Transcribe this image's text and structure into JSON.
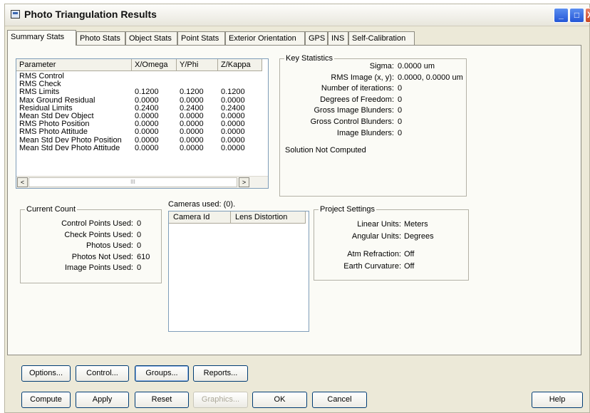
{
  "window": {
    "title": "Photo Triangulation Results",
    "controls": {
      "minimize": "_",
      "maximize": "□",
      "close": "X"
    }
  },
  "tabs": [
    {
      "label": "Summary Stats",
      "accel": "S",
      "active": true
    },
    {
      "label": "Photo Stats",
      "accel": "t",
      "active": false
    },
    {
      "label": "Object Stats",
      "accel": "b",
      "active": false
    },
    {
      "label": "Point Stats",
      "accel": "i",
      "active": false
    },
    {
      "label": "Exterior Orientation",
      "accel": "x",
      "active": false
    },
    {
      "label": "GPS",
      "accel": "",
      "active": false
    },
    {
      "label": "INS",
      "accel": "",
      "active": false
    },
    {
      "label": "Self-Calibration",
      "accel": "",
      "active": false
    }
  ],
  "summary_table": {
    "columns": [
      "Parameter",
      "X/Omega",
      "Y/Phi",
      "Z/Kappa"
    ],
    "rows": [
      [
        "RMS Control",
        "",
        "",
        ""
      ],
      [
        "RMS Check",
        "",
        "",
        ""
      ],
      [
        "RMS Limits",
        "0.1200",
        "0.1200",
        "0.1200"
      ],
      [
        "Max Ground Residual",
        "0.0000",
        "0.0000",
        "0.0000"
      ],
      [
        "Residual Limits",
        "0.2400",
        "0.2400",
        "0.2400"
      ],
      [
        "Mean Std Dev Object",
        "0.0000",
        "0.0000",
        "0.0000"
      ],
      [
        "RMS Photo Position",
        "0.0000",
        "0.0000",
        "0.0000"
      ],
      [
        "RMS Photo Attitude",
        "0.0000",
        "0.0000",
        "0.0000"
      ],
      [
        "Mean Std Dev Photo Position",
        "0.0000",
        "0.0000",
        "0.0000"
      ],
      [
        "Mean Std Dev Photo Attitude",
        "0.0000",
        "0.0000",
        "0.0000"
      ]
    ],
    "scroll_left": "<",
    "scroll_right": ">",
    "thumb_grip": "III"
  },
  "key_statistics": {
    "legend": "Key Statistics",
    "items": [
      {
        "label": "Sigma:",
        "value": "0.0000  um"
      },
      {
        "label": "RMS Image (x, y):",
        "value": "0.0000,  0.0000  um"
      },
      {
        "label": "Number of iterations:",
        "value": "0"
      },
      {
        "label": "Degrees of Freedom:",
        "value": "0"
      },
      {
        "label": "Gross Image Blunders:",
        "value": "0"
      },
      {
        "label": "Gross Control Blunders:",
        "value": "0"
      },
      {
        "label": "Image Blunders:",
        "value": "0"
      }
    ],
    "status": "Solution Not Computed"
  },
  "current_count": {
    "legend": "Current Count",
    "items": [
      {
        "label": "Control Points Used:",
        "value": "0"
      },
      {
        "label": "Check Points Used:",
        "value": "0"
      },
      {
        "label": "Photos Used:",
        "value": "0"
      },
      {
        "label": "Photos Not Used:",
        "value": "610"
      },
      {
        "label": "Image Points Used:",
        "value": "0"
      }
    ]
  },
  "cameras": {
    "label": "Cameras used: (0).",
    "columns": [
      "Camera Id",
      "Lens Distortion"
    ]
  },
  "project_settings": {
    "legend": "Project Settings",
    "items": [
      {
        "label": "Linear Units:",
        "value": "Meters"
      },
      {
        "label": "Angular Units:",
        "value": "Degrees"
      },
      {
        "label": "Atm Refraction:",
        "value": "Off"
      },
      {
        "label": "Earth Curvature:",
        "value": "Off"
      }
    ]
  },
  "buttons": {
    "options": "Options...",
    "control": "Control...",
    "groups": "Groups...",
    "reports": "Reports...",
    "compute": "Compute",
    "apply": "Apply",
    "reset": "Reset",
    "graphics": "Graphics...",
    "ok": "OK",
    "cancel": "Cancel",
    "help": "Help"
  }
}
